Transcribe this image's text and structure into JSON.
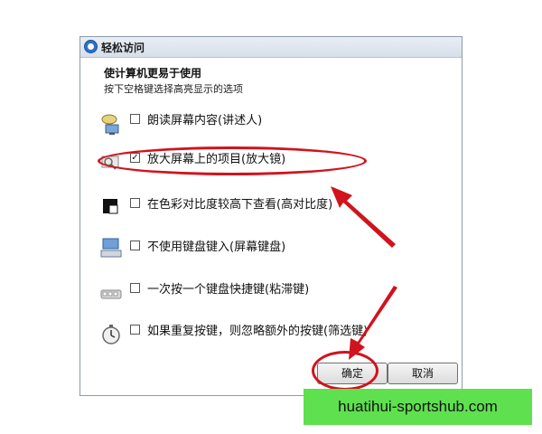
{
  "window": {
    "title": "轻松访问"
  },
  "header": {
    "heading": "使计算机更易于使用",
    "subheading": "按下空格键选择高亮显示的选项"
  },
  "options": [
    {
      "label": "朗读屏幕内容(讲述人)",
      "checked": false,
      "icon": "narrator-icon"
    },
    {
      "label": "放大屏幕上的项目(放大镜)",
      "checked": true,
      "icon": "magnifier-icon"
    },
    {
      "label": "在色彩对比度较高下查看(高对比度)",
      "checked": false,
      "icon": "high-contrast-icon"
    },
    {
      "label": "不使用键盘键入(屏幕键盘)",
      "checked": false,
      "icon": "on-screen-keyboard-icon"
    },
    {
      "label": "一次按一个键盘快捷键(粘滞键)",
      "checked": false,
      "icon": "sticky-keys-icon"
    },
    {
      "label": "如果重复按键，则忽略额外的按键(筛选键)",
      "checked": false,
      "icon": "filter-keys-icon"
    }
  ],
  "buttons": {
    "ok_label": "确定",
    "cancel_label": "取消"
  },
  "annotation_color": "#d0131d",
  "watermark": {
    "text": "huatihui-sportshub.com",
    "background": "#5fe04f"
  }
}
